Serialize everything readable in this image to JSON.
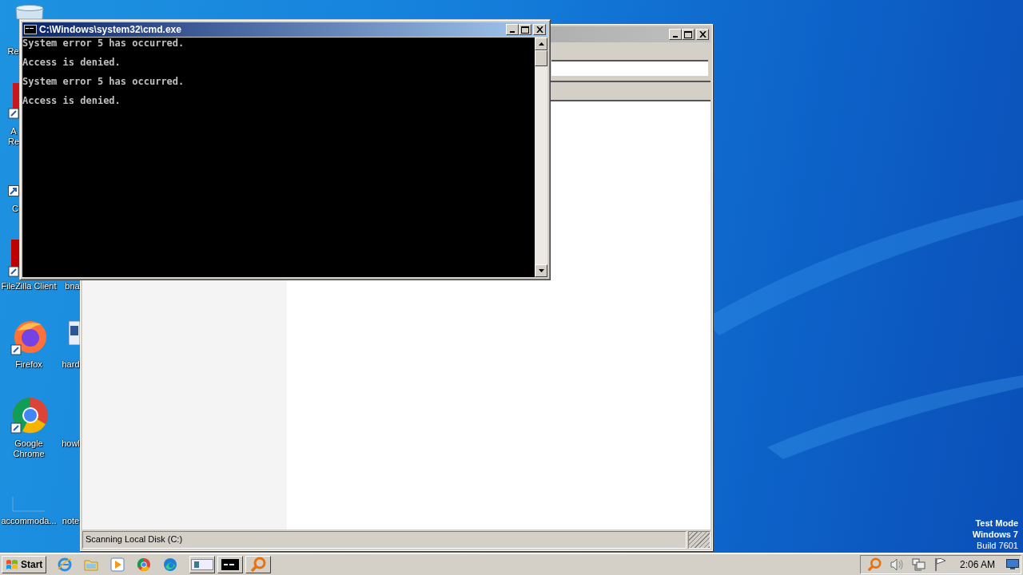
{
  "desktop_icons": [
    {
      "kind": "recycle",
      "label": "Re"
    },
    {
      "kind": "pdf",
      "label": "A Re"
    },
    {
      "kind": "shortcut",
      "label": "C"
    },
    {
      "kind": "filezilla",
      "label": "FileZilla Client"
    },
    {
      "kind": "none",
      "label": "bna"
    },
    {
      "kind": "firefox",
      "label": "Firefox"
    },
    {
      "kind": "word",
      "label": "hard"
    },
    {
      "kind": "chrome",
      "label": "Google Chrome"
    },
    {
      "kind": "none",
      "label": "howl"
    },
    {
      "kind": "blank",
      "label": "accommoda..."
    },
    {
      "kind": "none",
      "label": "note"
    }
  ],
  "explorer_window": {
    "status_text": "Scanning Local Disk (C:)"
  },
  "cmd_window": {
    "title": "C:\\Windows\\system32\\cmd.exe",
    "lines": [
      "System error 5 has occurred.",
      "Access is denied.",
      "System error 5 has occurred.",
      "Access is denied."
    ]
  },
  "desktop_notice": [
    "Test Mode",
    "Windows 7",
    "Build 7601"
  ],
  "taskbar": {
    "start_label": "Start",
    "pinned": [
      {
        "kind": "ie"
      },
      {
        "kind": "folder"
      },
      {
        "kind": "media"
      },
      {
        "kind": "chrome"
      },
      {
        "kind": "edge"
      }
    ],
    "tasks": [
      {
        "kind": "window"
      },
      {
        "kind": "console"
      },
      {
        "kind": "search"
      }
    ],
    "tray": [
      {
        "kind": "search"
      },
      {
        "kind": "volume"
      },
      {
        "kind": "network"
      },
      {
        "kind": "flag"
      }
    ],
    "clock": "2:06 AM"
  }
}
